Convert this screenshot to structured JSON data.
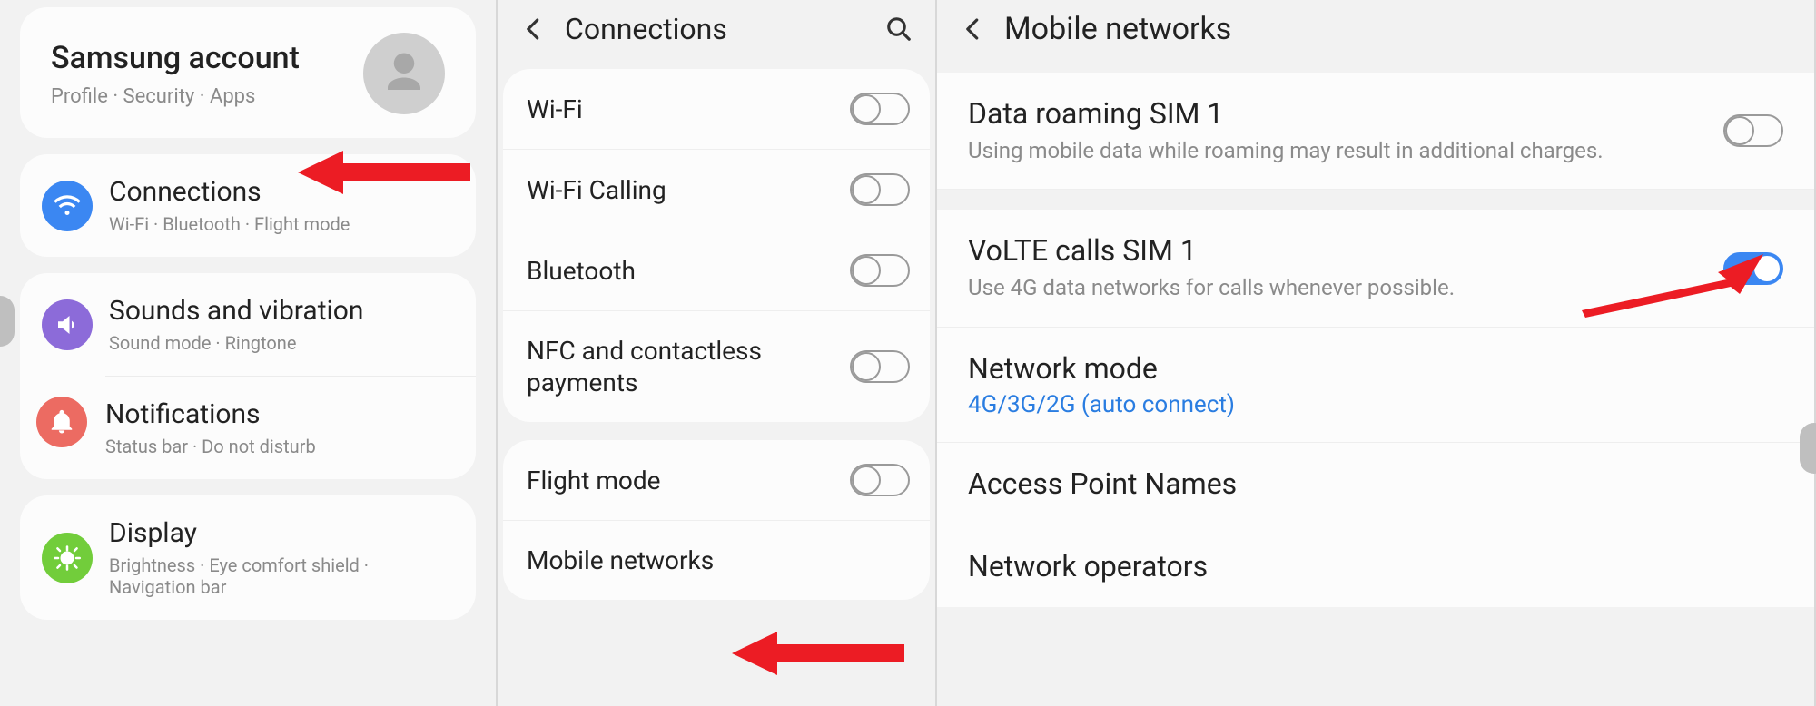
{
  "panel1": {
    "account": {
      "title": "Samsung account",
      "sub": "Profile  ·  Security  ·  Apps"
    },
    "groups": [
      {
        "rows": [
          {
            "icon": "wifi",
            "title": "Connections",
            "sub": "Wi-Fi  ·  Bluetooth  ·  Flight mode"
          }
        ]
      },
      {
        "rows": [
          {
            "icon": "sound",
            "title": "Sounds and vibration",
            "sub": "Sound mode  ·  Ringtone"
          },
          {
            "icon": "notif",
            "title": "Notifications",
            "sub": "Status bar  ·  Do not disturb"
          }
        ]
      },
      {
        "rows": [
          {
            "icon": "display",
            "title": "Display",
            "sub": "Brightness  ·  Eye comfort shield  ·  Navigation bar"
          }
        ]
      }
    ]
  },
  "panel2": {
    "title": "Connections",
    "groups": [
      [
        {
          "label": "Wi-Fi",
          "toggle": false
        },
        {
          "label": "Wi-Fi Calling",
          "toggle": false
        },
        {
          "label": "Bluetooth",
          "toggle": false
        },
        {
          "label": "NFC and contactless payments",
          "toggle": false
        }
      ],
      [
        {
          "label": "Flight mode",
          "toggle": false
        },
        {
          "label": "Mobile networks",
          "toggle": null
        }
      ]
    ]
  },
  "panel3": {
    "title": "Mobile networks",
    "items": [
      {
        "title": "Data roaming SIM 1",
        "sub": "Using mobile data while roaming may result in additional charges.",
        "toggle": false
      },
      {
        "title": "VoLTE calls SIM 1",
        "sub": "Use 4G data networks for calls whenever possible.",
        "toggle": true
      },
      {
        "title": "Network mode",
        "value": "4G/3G/2G (auto connect)"
      },
      {
        "title": "Access Point Names"
      },
      {
        "title": "Network operators"
      }
    ]
  }
}
